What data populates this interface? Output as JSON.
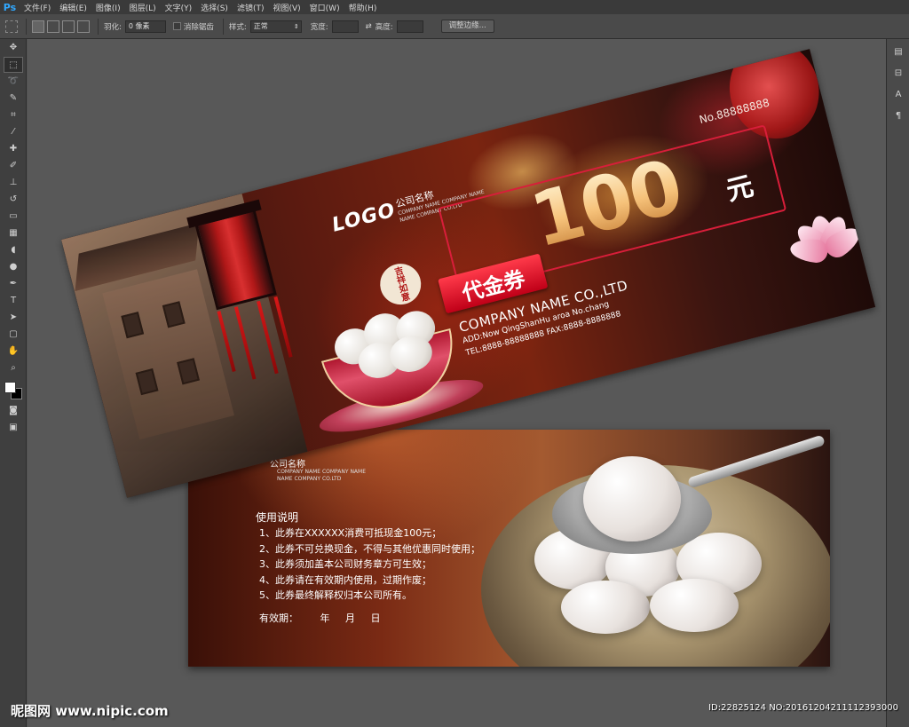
{
  "app": {
    "logo": "Ps",
    "menu": [
      "文件(F)",
      "编辑(E)",
      "图像(I)",
      "图层(L)",
      "文字(Y)",
      "选择(S)",
      "滤镜(T)",
      "视图(V)",
      "窗口(W)",
      "帮助(H)"
    ]
  },
  "options": {
    "feather_label": "羽化:",
    "feather_value": "0 像素",
    "antialias_label": "消除锯齿",
    "style_label": "样式:",
    "style_value": "正常",
    "width_label": "宽度:",
    "height_label": "高度:",
    "refine_button": "调整边缘..."
  },
  "front": {
    "logo": "LOGO",
    "company_cn": "公司名称",
    "company_en_1": "COMPANY NAME COMPANY NAME",
    "company_en_2": "NAME COMPANY CO.LTD",
    "serial": "No.88888888",
    "value": "100",
    "unit": "元",
    "badge": "代金券",
    "stamp": "吉祥如意",
    "company_name": "COMPANY NAME CO.,LTD",
    "address": "ADD:Now QingShanHu aroa No.chang",
    "tel": "TEL:8888-88888888    FAX:8888-8888888"
  },
  "back": {
    "company_cn": "公司名称",
    "company_en_1": "COMPANY NAME COMPANY NAME",
    "company_en_2": "NAME COMPANY CO.LTD",
    "usage_title": "使用说明",
    "rules": [
      "1、此券在XXXXXX消费可抵现金100元；",
      "2、此券不可兑换现金，不得与其他优惠同时使用；",
      "3、此券须加盖本公司财务章方可生效；",
      "4、此券请在有效期内使用，过期作废；",
      "5、此券最终解释权归本公司所有。"
    ],
    "validity": "有效期：       年     月     日"
  },
  "watermark": {
    "left": "昵图网 www.nipic.com",
    "right": "ID:22825124 NO:20161204211112393000"
  }
}
